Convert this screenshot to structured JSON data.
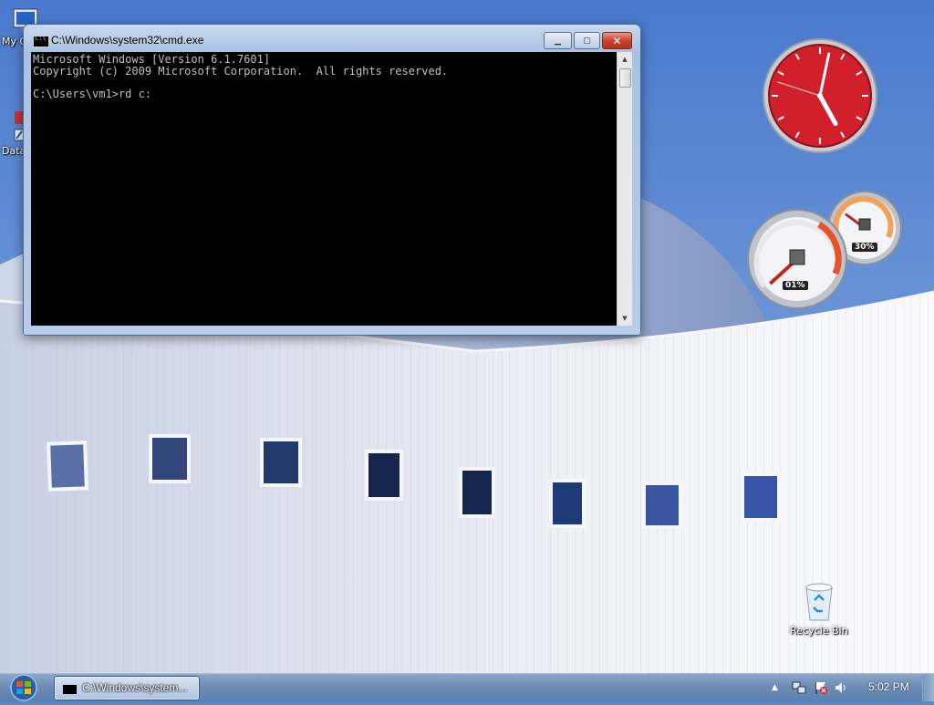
{
  "desktop": {
    "icons": {
      "my_computer": "My C",
      "data": "Data",
      "recycle_bin": "Recycle Bin"
    }
  },
  "cmd_window": {
    "title": "C:\\Windows\\system32\\cmd.exe",
    "console_lines": [
      "Microsoft Windows [Version 6.1.7601]",
      "Copyright (c) 2009 Microsoft Corporation.  All rights reserved.",
      "",
      "C:\\Users\\vm1>rd c:"
    ]
  },
  "gadgets": {
    "clock": {
      "hour": 5,
      "minute": 2,
      "second": 48
    },
    "meter": {
      "cpu_text": "01%",
      "memory_text": "30%",
      "cpu_percent": 1,
      "memory_percent": 30
    }
  },
  "taskbar": {
    "cmd_task_label": "C:\\Windows\\system...",
    "time": "5:02 PM"
  },
  "colors": {
    "sky": "#4f7fcf",
    "building": "#e6eaf2",
    "clock_face": "#d4212c",
    "taskbar": "#6d8db7"
  }
}
